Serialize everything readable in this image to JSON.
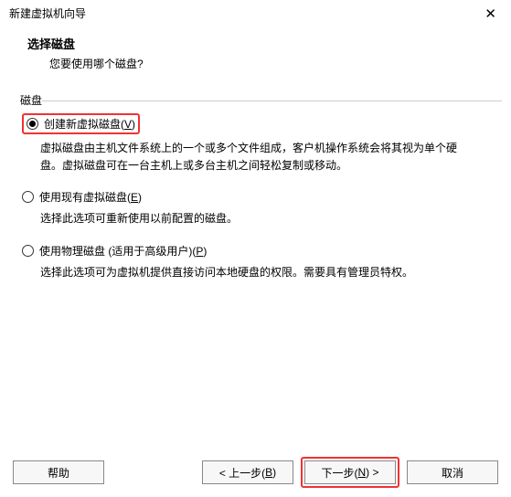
{
  "window": {
    "title": "新建虚拟机向导",
    "close_glyph": "✕"
  },
  "header": {
    "title": "选择磁盘",
    "subtitle": "您要使用哪个磁盘?"
  },
  "group_label": "磁盘",
  "options": {
    "opt1": {
      "label_pre": "创建新虚拟磁盘(",
      "label_key": "V",
      "label_post": ")",
      "desc": "虚拟磁盘由主机文件系统上的一个或多个文件组成，客户机操作系统会将其视为单个硬盘。虚拟磁盘可在一台主机上或多台主机之间轻松复制或移动。"
    },
    "opt2": {
      "label_pre": "使用现有虚拟磁盘(",
      "label_key": "E",
      "label_post": ")",
      "desc": "选择此选项可重新使用以前配置的磁盘。"
    },
    "opt3": {
      "label_pre": "使用物理磁盘 (适用于高级用户)(",
      "label_key": "P",
      "label_post": ")",
      "desc": "选择此选项可为虚拟机提供直接访问本地硬盘的权限。需要具有管理员特权。"
    }
  },
  "buttons": {
    "help": "帮助",
    "back_pre": "< 上一步(",
    "back_key": "B",
    "back_post": ")",
    "next_pre": "下一步(",
    "next_key": "N",
    "next_post": ") >",
    "cancel": "取消"
  }
}
